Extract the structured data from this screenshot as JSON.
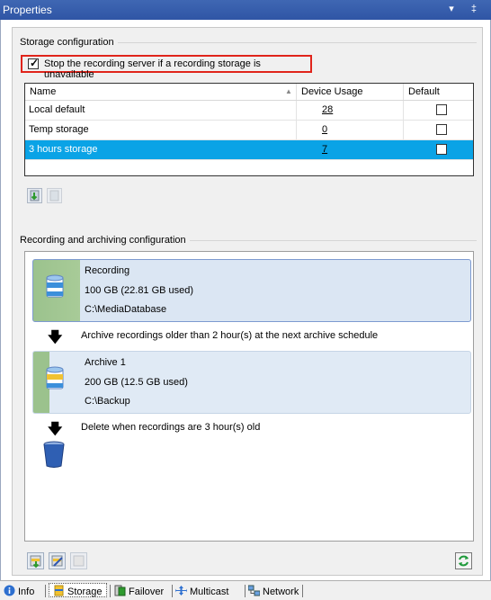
{
  "window": {
    "title": "Properties",
    "title_icons": "▾ ‡"
  },
  "storage_config": {
    "group_title": "Storage configuration",
    "stop_checkbox_label": "Stop the recording server if a recording storage is unavailable",
    "stop_checked": true,
    "columns": [
      "Name",
      "Device Usage",
      "Default"
    ],
    "rows": [
      {
        "name": "Local default",
        "usage": "28",
        "default": false,
        "selected": false
      },
      {
        "name": "Temp storage",
        "usage": "0",
        "default": false,
        "selected": false
      },
      {
        "name": "3 hours storage",
        "usage": "7",
        "default": true,
        "selected": true
      }
    ]
  },
  "archiving": {
    "group_title": "Recording and archiving configuration",
    "recording": {
      "name": "Recording",
      "size": "100 GB (22.81 GB used)",
      "path": "C:\\MediaDatabase"
    },
    "archive_rule": "Archive recordings older than 2 hour(s) at the next archive schedule",
    "archive1": {
      "name": "Archive 1",
      "size": "200 GB (12.5 GB used)",
      "path": "C:\\Backup"
    },
    "delete_rule": "Delete when recordings are 3 hour(s) old"
  },
  "tabs": [
    {
      "label": "Info",
      "icon": "info-icon",
      "active": false
    },
    {
      "label": "Storage",
      "icon": "storage-icon",
      "active": true
    },
    {
      "label": "Failover",
      "icon": "failover-icon",
      "active": false
    },
    {
      "label": "Multicast",
      "icon": "multicast-icon",
      "active": false
    },
    {
      "label": "Network",
      "icon": "network-icon",
      "active": false
    }
  ],
  "colors": {
    "title_bar": "#2f55a5",
    "selection": "#0aa3e6",
    "highlight_border": "#e0241b",
    "used_fill": "#9bc28d"
  }
}
